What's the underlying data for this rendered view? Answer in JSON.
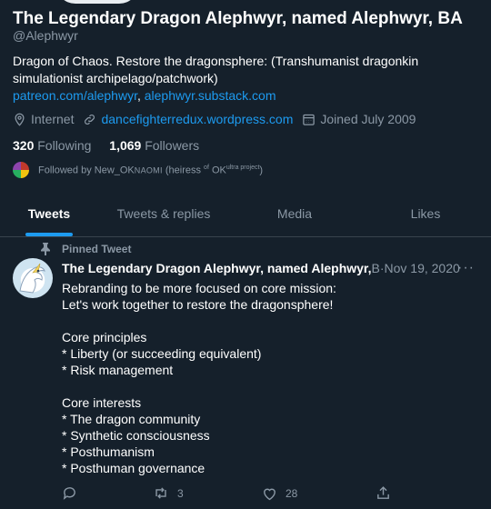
{
  "profile": {
    "display_name": "The Legendary Dragon Alephwyr, named Alephwyr, BA",
    "handle": "@Alephwyr",
    "bio_text": "Dragon of Chaos. Restore the dragonsphere: (Transhumanist dragonkin simulationist archipelago/patchwork)",
    "bio_link1": "patreon.com/alephwyr",
    "bio_sep": ",",
    "bio_link2": "alephwyr.substack.com",
    "location": "Internet",
    "website": "dancefighterredux.wordpress.com",
    "joined": "Joined July 2009",
    "following_count": "320",
    "following_label": "Following",
    "followers_count": "1,069",
    "followers_label": "Followers",
    "followed_by_prefix": "Followed by New_OK",
    "followed_by_sc": "NAOMI",
    "followed_by_mid": " (heiress ",
    "followed_by_sup1": "of",
    "followed_by_ok": " OK",
    "followed_by_sup2": "ultra project",
    "followed_by_end": ")"
  },
  "tabs": [
    {
      "label": "Tweets",
      "active": true
    },
    {
      "label": "Tweets & replies"
    },
    {
      "label": "Media"
    },
    {
      "label": "Likes"
    }
  ],
  "pinned_tweet": {
    "pinned_label": "Pinned Tweet",
    "author_name": "The Legendary Dragon Alephwyr, named Alephwyr,",
    "trailing": " B",
    "sep": " · ",
    "date": "Nov 19, 2020",
    "more": "···",
    "body": "Rebranding to be more focused on core mission:\nLet's work together to restore the dragonsphere!\n\nCore principles\n* Liberty (or succeeding equivalent)\n* Risk management\n\nCore interests\n* The dragon community\n* Synthetic consciousness\n* Posthumanism\n* Posthuman governance",
    "retweets": "3",
    "likes": "28"
  },
  "colors": {
    "background": "#15202b",
    "accent": "#1d9bf0",
    "secondary_text": "#8b98a5"
  }
}
